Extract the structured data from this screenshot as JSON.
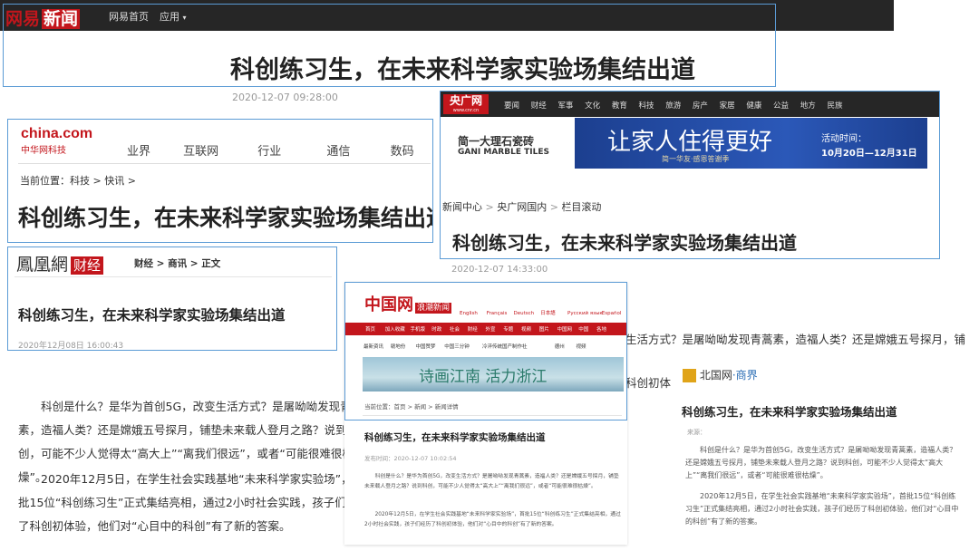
{
  "netease": {
    "logo_a": "网易",
    "logo_b": "新闻",
    "nav_home": "网易首页",
    "nav_apps": "应用",
    "title": "科创练习生，在未来科学家实验场集结出道",
    "date": "2020-12-07 09:28:00"
  },
  "china_com": {
    "logo": "china.com",
    "logo_sub": "中华网科技",
    "nav": [
      "业界",
      "互联网",
      "行业",
      "通信",
      "数码"
    ],
    "breadcrumb": "当前位置：科技 > 快讯 >",
    "title": "科创练习生，在未来科学家实验场集结出道"
  },
  "ifeng": {
    "logo": "鳳凰網",
    "logo_badge": "财经",
    "breadcrumb": "财经 > 商讯 > 正文",
    "title": "科创练习生，在未来科学家实验场集结出道",
    "date": "2020年12月08日 16:00:43"
  },
  "cnr": {
    "logo": "央广网",
    "logo_domain": "www.cnr.cn",
    "nav": [
      "要闻",
      "财经",
      "军事",
      "文化",
      "教育",
      "科技",
      "旅游",
      "房产",
      "家居",
      "健康",
      "公益",
      "地方",
      "民族"
    ],
    "ad_brand": "简一大理石瓷砖",
    "ad_brand_en": "GANI MARBLE TILES",
    "ad_slogan": "让家人住得更好",
    "ad_sub": "简一华友·感恩答谢季",
    "ad_period_label": "活动时间：",
    "ad_period": "10月20日—12月31日",
    "breadcrumb": [
      "新闻中心",
      "央广网国内",
      "栏目滚动"
    ],
    "title": "科创练习生，在未来科学家实验场集结出道",
    "date": "2020-12-07 14:33:00"
  },
  "main_article": {
    "p1": "科创是什么？是华为首创5G，改变生活方式？是屠呦呦发现青蒿素，造福人类？还是嫦娥五号探月，铺垫未来载人登月之路？说到科创，可能不少人觉得太“高大上”“离我们很远”，或者“可能很难很枯燥”。",
    "p2": "2020年12月5日，在学生社会实践基地“未来科学家实验场”，首批15位“科创练习生”正式集结亮相，通过2小时社会实践，孩子们经历了科创初体验，他们对“心目中的科创”有了新的答案。"
  },
  "china_cn": {
    "logo": "中国网",
    "logo_sub": "浪潮新闻",
    "langs": [
      "English",
      "Français",
      "Deutsch",
      "日本語",
      "Русский язык",
      "Español"
    ],
    "top_nav": [
      "首页",
      "加入收藏",
      "手机版",
      "时政",
      "社会",
      "财经",
      "外宣",
      "专题",
      "视频",
      "图片",
      "中国网",
      "中国",
      "各地"
    ],
    "sub_nav": [
      "最新资讯",
      "赣地份",
      "中国赞梦",
      "中国三分钟",
      "冷淬传统国产制作社",
      "德州",
      "视频"
    ],
    "banner_text": "诗画江南 活力浙江",
    "breadcrumb": "当前位置：首页 > 新闻 > 新闻详情",
    "title": "科创练习生，在未来科学家实验场集结出道",
    "date": "发布时间：2020-12-07 10:02:54",
    "p1": "科创是什么？是华为首创5G，改变生活方式？是屠呦呦发现青蒿素，造福人类？还是嫦娥五号探月，铺垫未来载人登月之路？说到科创，可能不少人觉得太“高大上”“离我们很远”，或者“可能很难很枯燥”。",
    "p2": "2020年12月5日，在学生社会实践基地“未来科学家实验场”，首批15位“科创练习生”正式集结亮相，通过2小时社会实践，孩子们经历了科创初体验，他们对“心目中的科创”有了新的答案。"
  },
  "bjd": {
    "logo": "北国网",
    "logo_sub": "·商界",
    "title": "科创练习生，在未来科学家实验场集结出道",
    "meta": "来源：",
    "p1": "科创是什么？是华为首创5G，改变生活方式？是屠呦呦发现青蒿素，造福人类？还是嫦娥五号探月，铺垫未来载人登月之路？说到科创，可能不少人觉得太“高大上”“离我们很远”，或者“可能很难很枯燥”。",
    "p2": "2020年12月5日，在学生社会实践基地“未来科学家实验场”，首批15位“科创练习生”正式集结亮相，通过2小时社会实践，孩子们经历了科创初体验，他们对“心目中的科创”有了新的答案。"
  },
  "colors": {
    "frame": "#5b9bd5",
    "netease_red": "#c3161c",
    "cnr_red": "#c4161c",
    "ad_blue": "#1c3f8f"
  }
}
